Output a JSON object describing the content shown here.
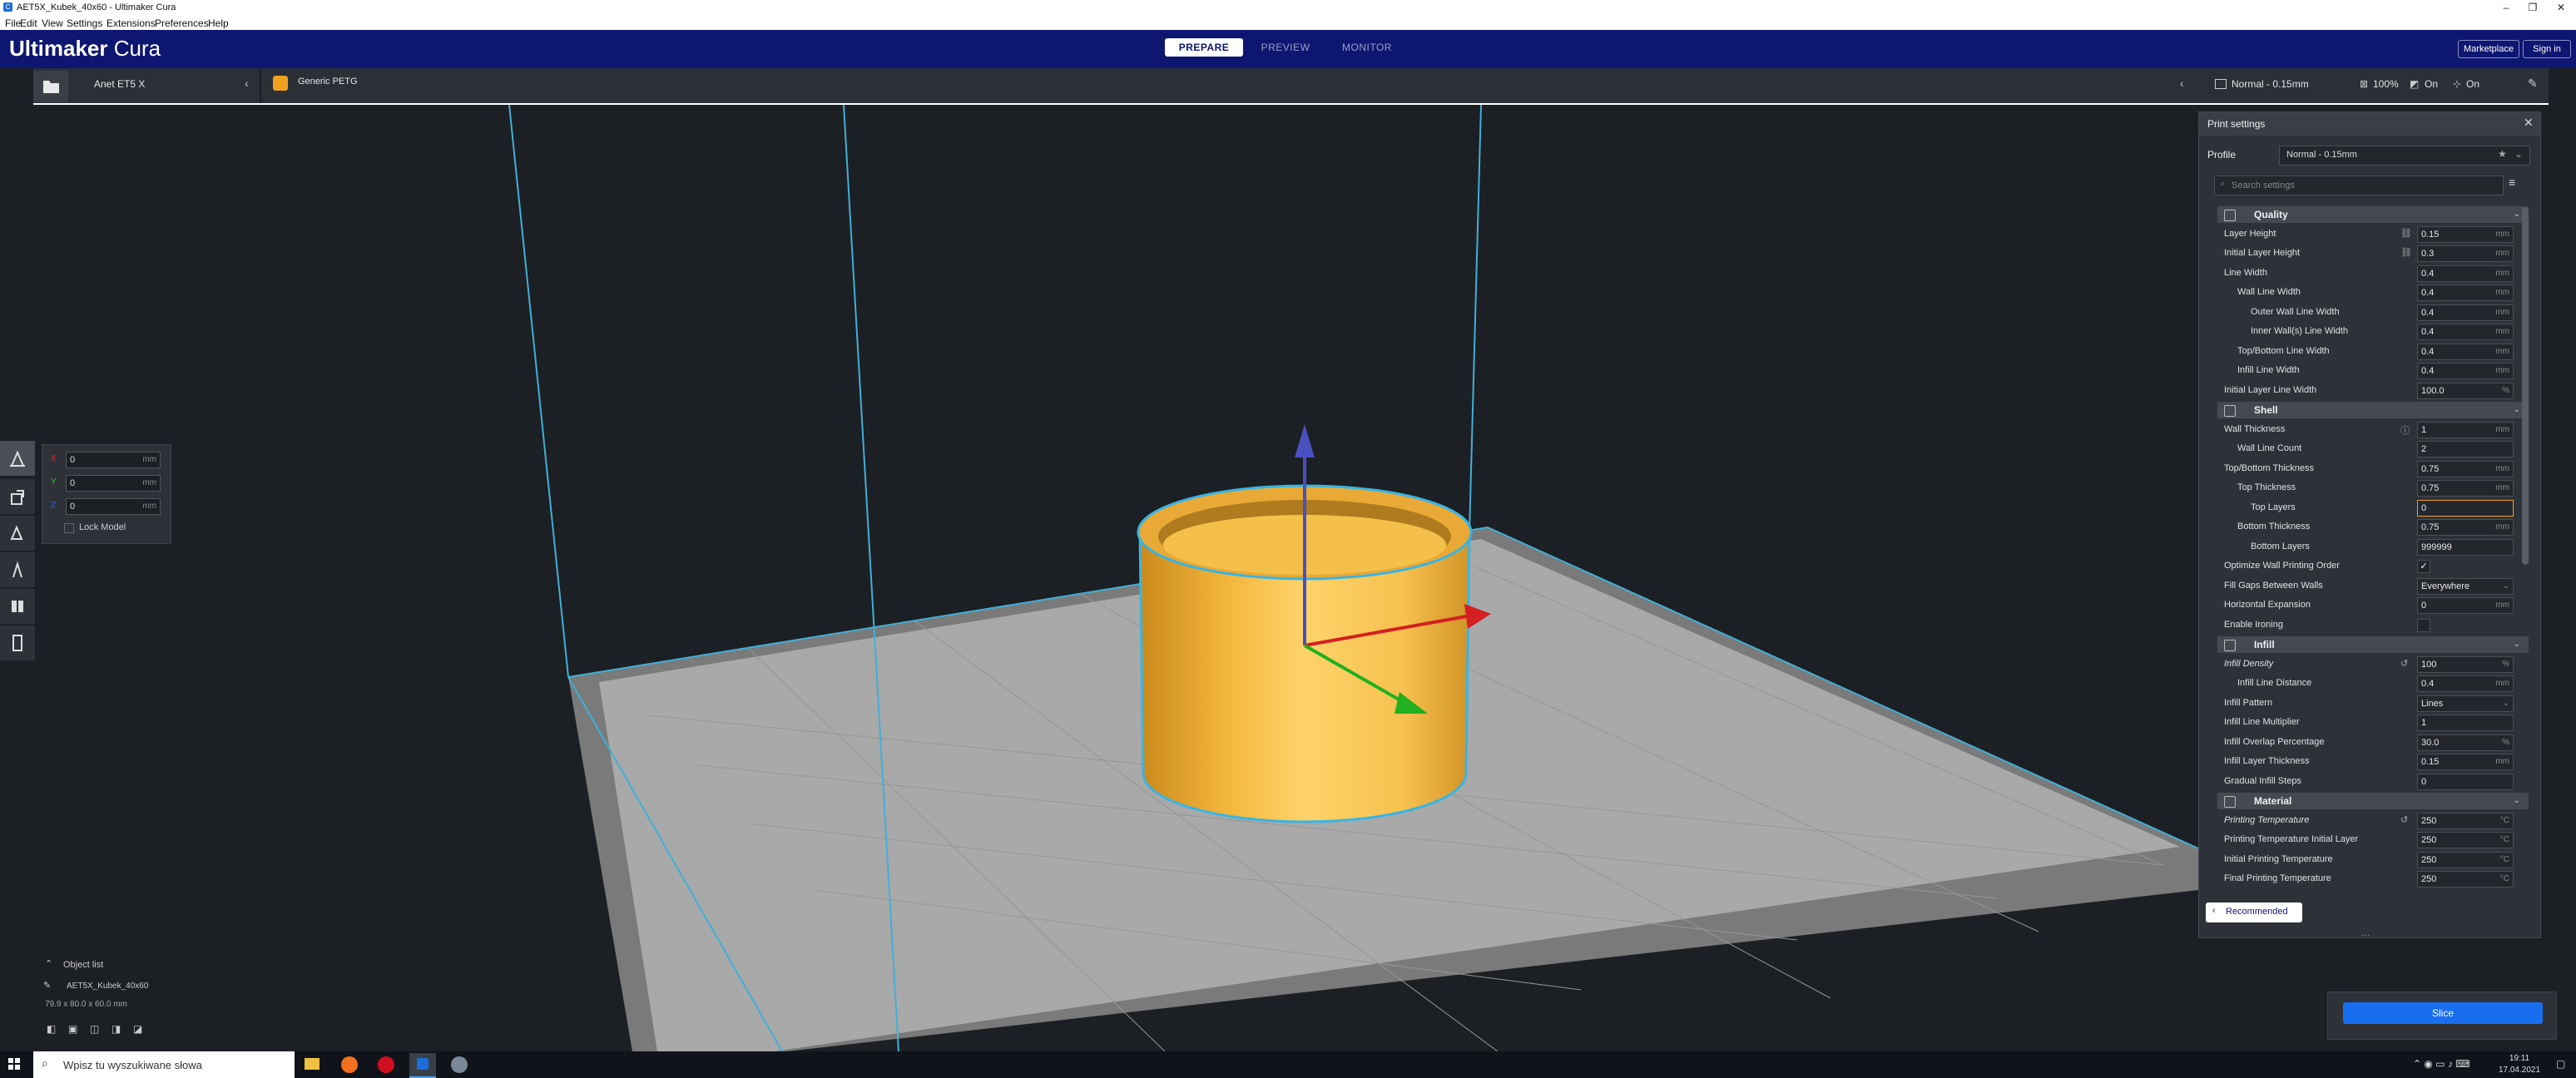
{
  "window": {
    "title": "AET5X_Kubek_40x60 - Ultimaker Cura",
    "app_icon": "C",
    "controls": {
      "min": "–",
      "max": "❐",
      "close": "✕"
    }
  },
  "menu": [
    "File",
    "Edit",
    "View",
    "Settings",
    "Extensions",
    "Preferences",
    "Help"
  ],
  "header": {
    "logo_bold": "Ultimaker",
    "logo_light": " Cura",
    "stages": [
      {
        "label": "PREPARE",
        "active": true
      },
      {
        "label": "PREVIEW",
        "active": false
      },
      {
        "label": "MONITOR",
        "active": false
      }
    ],
    "marketplace": "Marketplace",
    "signin": "Sign in"
  },
  "machine_bar": {
    "printer": "Anet ET5 X",
    "material": "Generic PETG",
    "profile": "Normal - 0.15mm",
    "infill": "100%",
    "support": "On",
    "adhesion": "On"
  },
  "move_panel": {
    "x": {
      "label": "X",
      "value": "0",
      "unit": "mm",
      "color": "#e02424"
    },
    "y": {
      "label": "Y",
      "value": "0",
      "unit": "mm",
      "color": "#22c422"
    },
    "z": {
      "label": "Z",
      "value": "0",
      "unit": "mm",
      "color": "#3b5bdb"
    },
    "lock_model": "Lock Model"
  },
  "print_settings": {
    "title": "Print settings",
    "profile_label": "Profile",
    "profile_value": "Normal - 0.15mm",
    "search_placeholder": "Search settings",
    "categories": [
      {
        "name": "Quality",
        "rows": [
          {
            "label": "Layer Height",
            "value": "0.15",
            "unit": "mm",
            "indent": 0,
            "icon": "link"
          },
          {
            "label": "Initial Layer Height",
            "value": "0.3",
            "unit": "mm",
            "indent": 0,
            "icon": "link"
          },
          {
            "label": "Line Width",
            "value": "0.4",
            "unit": "mm",
            "indent": 0
          },
          {
            "label": "Wall Line Width",
            "value": "0.4",
            "unit": "mm",
            "indent": 1
          },
          {
            "label": "Outer Wall Line Width",
            "value": "0.4",
            "unit": "mm",
            "indent": 2
          },
          {
            "label": "Inner Wall(s) Line Width",
            "value": "0.4",
            "unit": "mm",
            "indent": 2
          },
          {
            "label": "Top/Bottom Line Width",
            "value": "0.4",
            "unit": "mm",
            "indent": 1
          },
          {
            "label": "Infill Line Width",
            "value": "0.4",
            "unit": "mm",
            "indent": 1
          },
          {
            "label": "Initial Layer Line Width",
            "value": "100.0",
            "unit": "%",
            "indent": 0
          }
        ]
      },
      {
        "name": "Shell",
        "rows": [
          {
            "label": "Wall Thickness",
            "value": "1",
            "unit": "mm",
            "indent": 0,
            "icon": "info"
          },
          {
            "label": "Wall Line Count",
            "value": "2",
            "unit": "",
            "indent": 1
          },
          {
            "label": "Top/Bottom Thickness",
            "value": "0.75",
            "unit": "mm",
            "indent": 0
          },
          {
            "label": "Top Thickness",
            "value": "0.75",
            "unit": "mm",
            "indent": 1
          },
          {
            "label": "Top Layers",
            "value": "0",
            "unit": "",
            "indent": 2,
            "highlight": true
          },
          {
            "label": "Bottom Thickness",
            "value": "0.75",
            "unit": "mm",
            "indent": 1
          },
          {
            "label": "Bottom Layers",
            "value": "999999",
            "unit": "",
            "indent": 2
          },
          {
            "label": "Optimize Wall Printing Order",
            "value": "✓",
            "unit": "",
            "indent": 0,
            "type": "check"
          },
          {
            "label": "Fill Gaps Between Walls",
            "value": "Everywhere",
            "unit": "",
            "indent": 0,
            "type": "dropdown"
          },
          {
            "label": "Horizontal Expansion",
            "value": "0",
            "unit": "mm",
            "indent": 0
          },
          {
            "label": "Enable Ironing",
            "value": "",
            "unit": "",
            "indent": 0,
            "type": "check"
          }
        ]
      },
      {
        "name": "Infill",
        "rows": [
          {
            "label": "Infill Density",
            "value": "100",
            "unit": "%",
            "indent": 0,
            "icon": "reset",
            "italic": true
          },
          {
            "label": "Infill Line Distance",
            "value": "0.4",
            "unit": "mm",
            "indent": 1
          },
          {
            "label": "Infill Pattern",
            "value": "Lines",
            "unit": "",
            "indent": 0,
            "type": "dropdown"
          },
          {
            "label": "Infill Line Multiplier",
            "value": "1",
            "unit": "",
            "indent": 0
          },
          {
            "label": "Infill Overlap Percentage",
            "value": "30.0",
            "unit": "%",
            "indent": 0
          },
          {
            "label": "Infill Layer Thickness",
            "value": "0.15",
            "unit": "mm",
            "indent": 0
          },
          {
            "label": "Gradual Infill Steps",
            "value": "0",
            "unit": "",
            "indent": 0
          }
        ]
      },
      {
        "name": "Material",
        "rows": [
          {
            "label": "Printing Temperature",
            "value": "250",
            "unit": "°C",
            "indent": 0,
            "icon": "reset",
            "italic": true
          },
          {
            "label": "Printing Temperature Initial Layer",
            "value": "250",
            "unit": "°C",
            "indent": 0
          },
          {
            "label": "Initial Printing Temperature",
            "value": "250",
            "unit": "°C",
            "indent": 0
          },
          {
            "label": "Final Printing Temperature",
            "value": "250",
            "unit": "°C",
            "indent": 0
          }
        ]
      }
    ],
    "recommended": "Recommended"
  },
  "object_list": {
    "title": "Object list",
    "name": "AET5X_Kubek_40x60",
    "dims": "79.9 x 80.0 x 60.0 mm"
  },
  "slice": "Slice",
  "taskbar": {
    "search_placeholder": "Wpisz tu wyszukiwane słowa",
    "time": "19:11",
    "date": "17.04.2021"
  }
}
